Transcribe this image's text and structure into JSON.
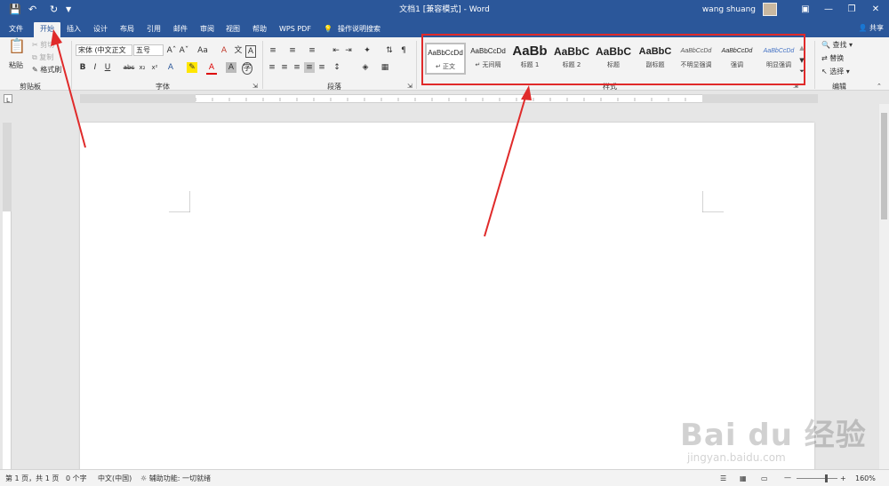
{
  "titlebar": {
    "title": "文档1 [兼容模式] - Word",
    "user": "wang shuang"
  },
  "tabs": [
    "文件",
    "开始",
    "插入",
    "设计",
    "布局",
    "引用",
    "邮件",
    "审阅",
    "视图",
    "帮助",
    "WPS PDF",
    "操作说明搜索"
  ],
  "share": "共享",
  "clipboard": {
    "paste": "粘贴",
    "cut": "剪切",
    "copy": "复制",
    "format_painter": "格式刷",
    "label": "剪贴板"
  },
  "font": {
    "name": "宋体 (中文正文",
    "size": "五号",
    "label": "字体"
  },
  "paragraph": {
    "label": "段落"
  },
  "styles": {
    "label": "样式",
    "items": [
      {
        "sample": "AaBbCcDd",
        "name": "↵ 正文"
      },
      {
        "sample": "AaBbCcDd",
        "name": "↵ 无间隔"
      },
      {
        "sample": "AaBb",
        "name": "标题 1"
      },
      {
        "sample": "AaBbC",
        "name": "标题 2"
      },
      {
        "sample": "AaBbC",
        "name": "标题"
      },
      {
        "sample": "AaBbC",
        "name": "副标题"
      },
      {
        "sample": "AaBbCcDd",
        "name": "不明显强调"
      },
      {
        "sample": "AaBbCcDd",
        "name": "强调"
      },
      {
        "sample": "AaBbCcDd",
        "name": "明显强调"
      }
    ]
  },
  "editing": {
    "find": "查找",
    "replace": "替换",
    "select": "选择",
    "label": "编辑"
  },
  "status": {
    "page": "第 1 页，共 1 页",
    "words": "0 个字",
    "lang": "中文(中国)",
    "accessibility": "辅助功能: 一切就绪",
    "zoom": "160%"
  },
  "watermark": {
    "main": "Bai du 经验",
    "sub": "jingyan.baidu.com"
  },
  "colors": {
    "accent": "#2b579a",
    "highlight_box": "#e02a2a",
    "arrow": "#e02a2a"
  }
}
